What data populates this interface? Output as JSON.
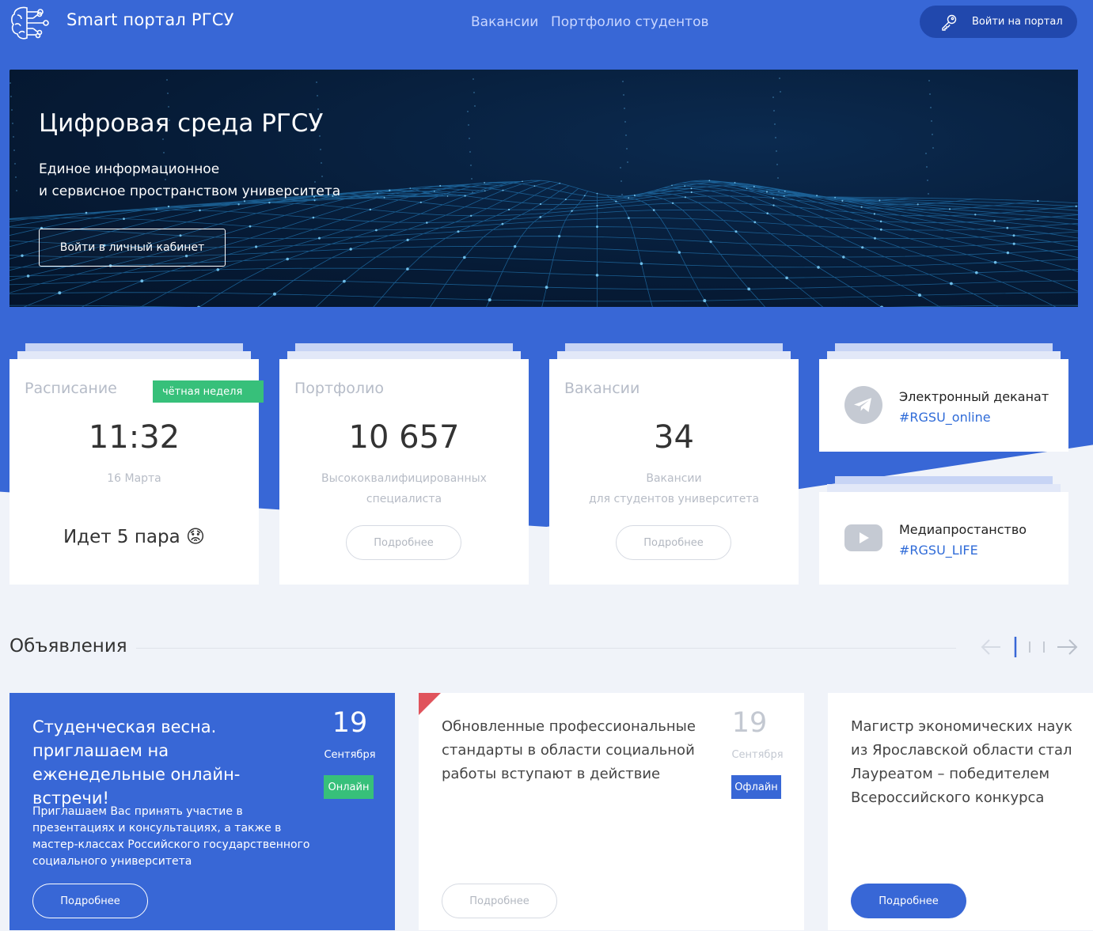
{
  "header": {
    "brand": "Smart портал РГСУ",
    "nav": [
      "Вакансии",
      "Портфолио студентов"
    ],
    "login_label": "Войти на портал"
  },
  "hero": {
    "title": "Цифровая среда РГСУ",
    "subtitle_line1": "Единое информационное",
    "subtitle_line2": "и сервисное пространством университета",
    "button": "Войти в личный кабинет"
  },
  "cards": {
    "schedule": {
      "label": "Расписание",
      "badge": "чётная неделя",
      "time": "11:32",
      "date": "16 Марта",
      "pair": "Идет 5 пара",
      "emoji": "😟"
    },
    "portfolio": {
      "label": "Портфолио",
      "value": "10 657",
      "caption_line1": "Высококвалифицированных",
      "caption_line2": "специалиста",
      "button": "Подробнее"
    },
    "vacancies": {
      "label": "Вакансии",
      "value": "34",
      "caption_line1": "Вакансии",
      "caption_line2": "для студентов университета",
      "button": "Подробнее"
    },
    "deanery": {
      "title": "Электронный деканат",
      "tag": "#RGSU_online",
      "icon": "telegram-icon"
    },
    "media": {
      "title": "Медиапростанство",
      "tag": "#RGSU_LIFE",
      "icon": "youtube-icon"
    }
  },
  "announcements": {
    "title": "Объявления",
    "items": [
      {
        "title": "Студенческая весна. приглашаем на еженедельные онлайн-встречи!",
        "day": "19",
        "month": "Сентября",
        "status": "Онлайн",
        "description": "Приглашаем Вас принять участие в презентациях и консультациях, а также в мастер-классах Российского государственного социального университета",
        "button": "Подробнее"
      },
      {
        "title": "Обновленные профессиональные стандарты в области социальной работы вступают в действие",
        "day": "19",
        "month": "Сентября",
        "status": "Офлайн",
        "button": "Подробнее"
      },
      {
        "title": "Магистр экономических наук из Ярославской области стал Лауреатом – победителем Всероссийского конкурса",
        "button": "Подробнее"
      }
    ]
  },
  "colors": {
    "brand_blue": "#3867d6",
    "dark_blue": "#2148ad",
    "green": "#37c07a",
    "link_blue": "#2f6bd8",
    "corner_red": "#e0535c"
  }
}
